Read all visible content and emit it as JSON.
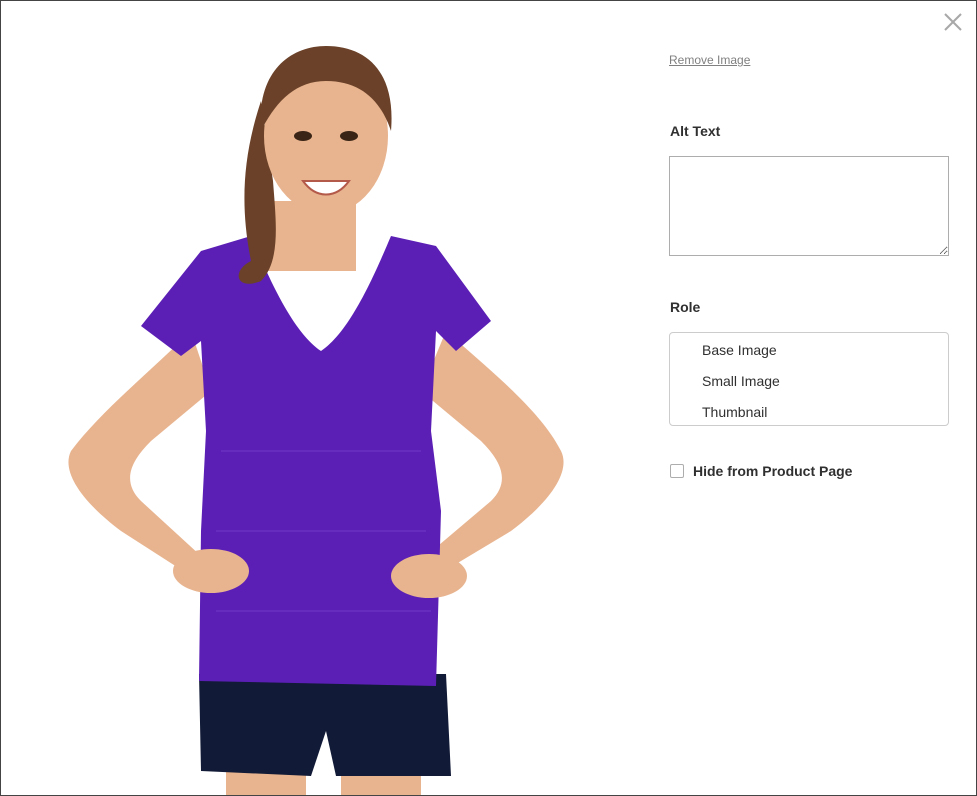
{
  "icons": {
    "close": "close-icon"
  },
  "image_panel": {
    "remove_link": "Remove Image"
  },
  "alt_text": {
    "label": "Alt Text",
    "value": ""
  },
  "role": {
    "label": "Role",
    "options": [
      "Base Image",
      "Small Image",
      "Thumbnail"
    ]
  },
  "hide_from_product_page": {
    "label": "Hide from Product Page",
    "checked": false
  },
  "colors": {
    "shirt": "#5b1fb5",
    "shorts": "#111a36",
    "skin": "#e8b48f",
    "hair": "#6b4229"
  }
}
